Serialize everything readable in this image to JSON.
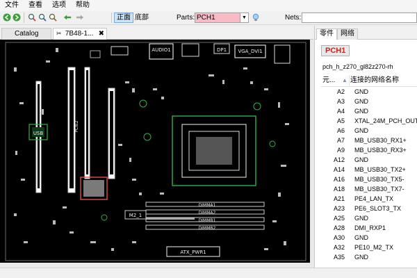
{
  "menu": [
    "文件",
    "查看",
    "选项",
    "帮助"
  ],
  "toolbar": {
    "icons": [
      "back-arrow-icon",
      "forward-arrow-icon",
      "zoom-in-icon",
      "zoom-out-icon",
      "zoom-fit-icon",
      "previous-icon",
      "next-icon"
    ],
    "view_front": "正面",
    "view_back": "底部",
    "parts_label": "Parts:",
    "parts_value": "PCH1",
    "nets_label": "Nets:"
  },
  "tabs": [
    {
      "label": "Catalog",
      "active": false
    },
    {
      "label": "7B48-1...",
      "active": true
    }
  ],
  "board": {
    "labels": [
      "AUDIO1",
      "DP1",
      "VGA_DVI1",
      "USB",
      "PCIE2",
      "M2_1",
      "DIMMA1",
      "DIMMA2",
      "DIMMB1",
      "DIMMB2",
      "ATX_PWR1"
    ]
  },
  "right_panel": {
    "tabs": [
      "零件",
      "网络"
    ],
    "part": "PCH1",
    "part_desc": "pch_h_z270_gl82z270-rh",
    "columns": {
      "pin": "元...",
      "net": "连接的网络名称"
    },
    "rows": [
      {
        "pin": "A2",
        "net": "GND"
      },
      {
        "pin": "A3",
        "net": "GND"
      },
      {
        "pin": "A4",
        "net": "GND"
      },
      {
        "pin": "A5",
        "net": "XTAL_24M_PCH_OUT"
      },
      {
        "pin": "A6",
        "net": "GND"
      },
      {
        "pin": "A7",
        "net": "MB_USB30_RX1+"
      },
      {
        "pin": "A9",
        "net": "MB_USB30_RX3+"
      },
      {
        "pin": "A12",
        "net": "GND"
      },
      {
        "pin": "A14",
        "net": "MB_USB30_TX2+"
      },
      {
        "pin": "A16",
        "net": "MB_USB30_TX5-"
      },
      {
        "pin": "A18",
        "net": "MB_USB30_TX7-"
      },
      {
        "pin": "A21",
        "net": "PE4_LAN_TX"
      },
      {
        "pin": "A23",
        "net": "PE6_SLOT3_TX"
      },
      {
        "pin": "A25",
        "net": "GND"
      },
      {
        "pin": "A28",
        "net": "DMI_RXP1"
      },
      {
        "pin": "A30",
        "net": "GND"
      },
      {
        "pin": "A32",
        "net": "PE10_M2_TX"
      },
      {
        "pin": "A35",
        "net": "GND"
      }
    ]
  },
  "colors": {
    "board_background": "#000000",
    "trace_green": "#2fb04a",
    "silkscreen": "#e0e0e0",
    "highlight": "#e05050",
    "parts_field": "#f9b9c5",
    "part_text": "#d02020"
  }
}
